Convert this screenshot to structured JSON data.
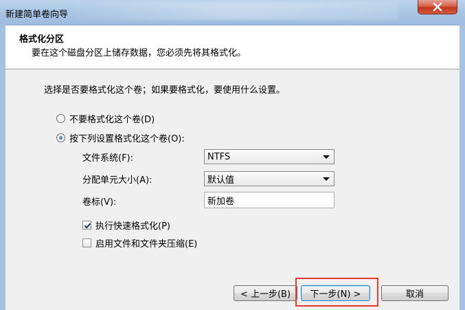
{
  "window": {
    "title": "新建简单卷向导",
    "close_icon": "close-icon"
  },
  "header": {
    "title": "格式化分区",
    "subtitle": "要在这个磁盘分区上储存数据，您必须先将其格式化。"
  },
  "main": {
    "lead": "选择是否要格式化这个卷；如果要格式化，要使用什么设置。",
    "radio_no_format": "不要格式化这个卷(D)",
    "radio_format": "按下列设置格式化这个卷(O):",
    "selected_radio": "format",
    "file_system_label": "文件系统(F):",
    "file_system_value": "NTFS",
    "alloc_unit_label": "分配单元大小(A):",
    "alloc_unit_value": "默认值",
    "volume_label_label": "卷标(V):",
    "volume_label_value": "新加卷",
    "quick_format_label": "执行快速格式化(P)",
    "quick_format_checked": true,
    "compression_label": "启用文件和文件夹压缩(E)",
    "compression_checked": false
  },
  "buttons": {
    "back": "< 上一步(B)",
    "next": "下一步(N) >",
    "cancel": "取消"
  },
  "colors": {
    "highlight": "#e53935",
    "close_button": "#c1361f"
  }
}
